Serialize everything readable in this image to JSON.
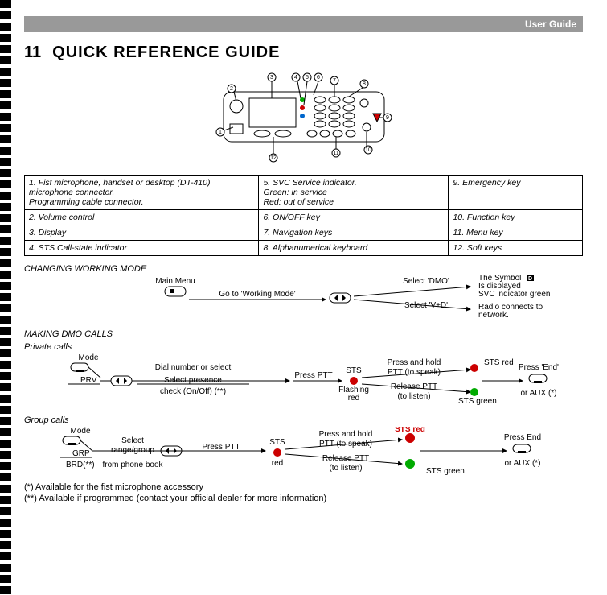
{
  "header": {
    "user_guide": "User Guide"
  },
  "chapter": {
    "num": "11",
    "title": "QUICK REFERENCE GUIDE"
  },
  "callouts": {
    "c1": "1",
    "c2": "2",
    "c3": "3",
    "c4": "4",
    "c5": "5",
    "c6": "6",
    "c7": "7",
    "c8": "8",
    "c9": "9",
    "c10": "10",
    "c11": "11",
    "c12": "12"
  },
  "legend": {
    "r1c1a": "1. Fist microphone, handset or desktop (DT-410) microphone connector.",
    "r1c1b": "Programming cable connector.",
    "r1c2a": "5. SVC Service indicator.",
    "r1c2b": "Green: in service",
    "r1c2c": "Red: out of service",
    "r1c3": "9. Emergency key",
    "r2c1": "2. Volume control",
    "r2c2": "6. ON/OFF key",
    "r2c3": "10. Function key",
    "r3c1": "3. Display",
    "r3c2": "7. Navigation keys",
    "r3c3": "11. Menu key",
    "r4c1": "4. STS Call-state indicator",
    "r4c2": "8. Alphanumerical keyboard",
    "r4c3": "12. Soft keys"
  },
  "changing": {
    "title": "CHANGING WORKING MODE",
    "main_menu": "Main Menu",
    "goto": "Go to 'Working Mode'",
    "select_dmo": "Select 'DMO'",
    "select_vd": "Select 'V+D'",
    "symbol_a": "The Symbol",
    "symbol_b": "Is displayed",
    "svc_green": "SVC indicator green",
    "radio_a": "Radio connects to",
    "radio_b": "network."
  },
  "private": {
    "title": "MAKING DMO CALLS",
    "subtitle": "Private calls",
    "mode": "Mode",
    "prv": "PRV",
    "dial": "Dial number or select",
    "presence": "Select presence",
    "check": "check (On/Off) (**)",
    "press_ptt": "Press PTT",
    "sts": "STS",
    "flashing": "Flashing",
    "red": "red",
    "hold_a": "Press and hold",
    "hold_b": "PTT (to speak)",
    "release_a": "Release PTT",
    "release_b": "(to listen)",
    "sts_red": "STS red",
    "sts_green": "STS green",
    "press_end": "Press 'End'",
    "or_aux": "or AUX (*)"
  },
  "group": {
    "title": "Group calls",
    "mode": "Mode",
    "grp": "GRP",
    "brd": "BRD(**)",
    "select": "Select",
    "range": "range/group",
    "phonebook": "from phone book",
    "press_ptt": "Press PTT",
    "sts": "STS",
    "red": "red",
    "hold_a": "Press and hold",
    "hold_b": "PTT (to speak)",
    "release_a": "Release PTT",
    "release_b": "(to listen)",
    "sts_red": "STS red",
    "sts_green": "STS green",
    "press_end": "Press End",
    "or_aux": "or AUX (*)"
  },
  "footnotes": {
    "f1": "(*) Available for the fist microphone accessory",
    "f2": "(**) Available if programmed (contact your official dealer for more information)"
  }
}
